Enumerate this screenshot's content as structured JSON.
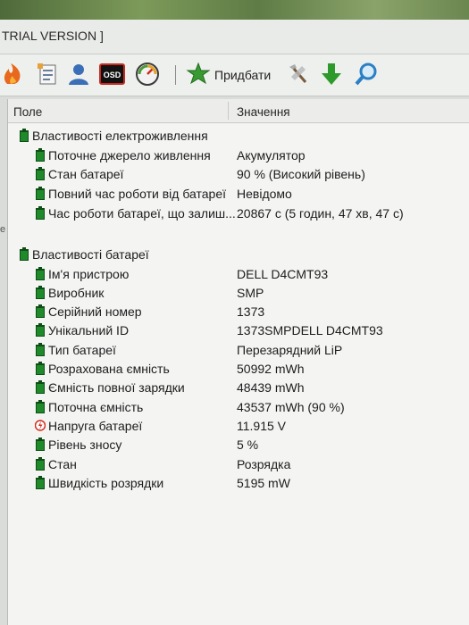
{
  "window": {
    "title": "TRIAL VERSION ]"
  },
  "toolbar": {
    "icons": [
      "flame-icon",
      "report-icon",
      "user-icon",
      "osd-icon",
      "gauge-icon",
      "add-star-icon",
      "tools-icon",
      "download-arrow-icon",
      "search-icon"
    ],
    "osd_label": "OSD",
    "add_label": "Придбати"
  },
  "table": {
    "col_field": "Поле",
    "col_value": "Значення"
  },
  "groups": [
    {
      "title": "Властивості електроживлення",
      "rows": [
        {
          "field": "Поточне джерело живлення",
          "value": "Акумулятор"
        },
        {
          "field": "Стан батареї",
          "value": "90 % (Високий рівень)"
        },
        {
          "field": "Повний час роботи від батареї",
          "value": "Невідомо"
        },
        {
          "field": "Час роботи батареї, що залиш...",
          "value": "20867 с (5 годин, 47 хв, 47 с)"
        }
      ]
    },
    {
      "title": "Властивості батареї",
      "rows": [
        {
          "field": "Ім'я пристрою",
          "value": "DELL D4CMT93"
        },
        {
          "field": "Виробник",
          "value": "SMP"
        },
        {
          "field": "Серійний номер",
          "value": "1373"
        },
        {
          "field": "Унікальний ID",
          "value": "1373SMPDELL D4CMT93"
        },
        {
          "field": "Тип батареї",
          "value": "Перезарядний LiP"
        },
        {
          "field": "Розрахована ємність",
          "value": "50992 mWh"
        },
        {
          "field": "Ємність повної зарядки",
          "value": "48439 mWh"
        },
        {
          "field": "Поточна ємність",
          "value": "43537 mWh  (90 %)"
        },
        {
          "field": "Напруга батареї",
          "value": "11.915 V"
        },
        {
          "field": "Рівень зносу",
          "value": "5 %"
        },
        {
          "field": "Стан",
          "value": "Розрядка"
        },
        {
          "field": "Швидкість розрядки",
          "value": "5195 mW"
        }
      ]
    }
  ],
  "side_mark": "e",
  "colors": {
    "battery_green": "#1f8a2a",
    "battery_dark": "#0f4d16",
    "voltage_red": "#d22b1e"
  }
}
